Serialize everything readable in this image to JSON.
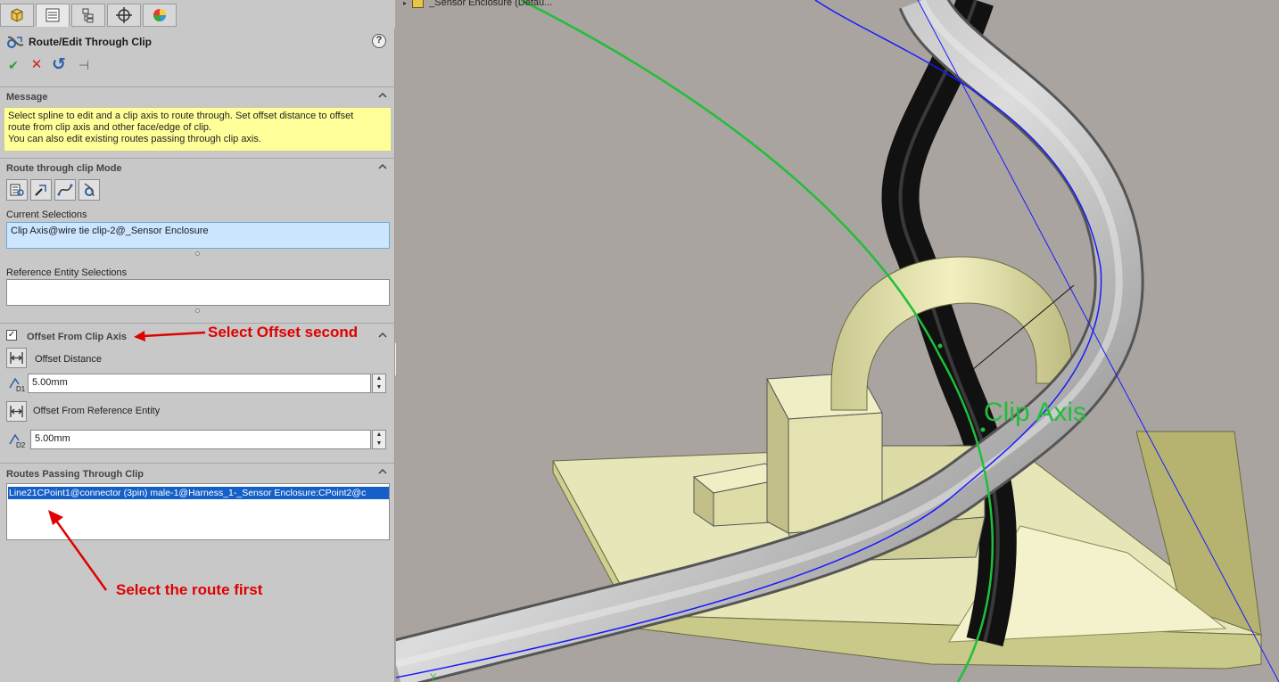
{
  "tabs": [
    {
      "name": "feature-manager",
      "icon": "feature-tree-icon"
    },
    {
      "name": "property-manager",
      "icon": "property-manager-icon"
    },
    {
      "name": "configuration-manager",
      "icon": "configuration-icon"
    },
    {
      "name": "dimxpert-manager",
      "icon": "crosshair-icon"
    },
    {
      "name": "display-manager",
      "icon": "appearance-icon"
    }
  ],
  "header": {
    "title": "Route/Edit Through Clip",
    "help": "?",
    "ok": "✔",
    "cancel": "✕",
    "undo": "↺",
    "pin": "⊣"
  },
  "message": {
    "title": "Message",
    "lines": [
      "Select spline to edit and a clip axis to route through. Set offset distance to offset",
      "route from clip axis and other face/edge of clip.",
      "You can also edit existing routes passing through clip axis."
    ]
  },
  "mode": {
    "title": "Route through clip Mode",
    "buttons": [
      "route-through-clip-icon",
      "select-spline-icon",
      "edit-spline-icon",
      "clip-axis-icon"
    ]
  },
  "current_selections": {
    "label": "Current Selections",
    "value": "Clip Axis@wire tie clip-2@_Sensor Enclosure"
  },
  "reference_entity": {
    "label": "Reference Entity Selections",
    "value": ""
  },
  "offset": {
    "checked": true,
    "title": "Offset From Clip Axis",
    "distance_label": "Offset Distance",
    "distance_value": "5.00mm",
    "distance_icon_text": "D1",
    "reference_label": "Offset From Reference Entity",
    "reference_value": "5.00mm",
    "reference_icon_text": "D2"
  },
  "routes": {
    "title": "Routes Passing Through Clip",
    "items": [
      "Line21CPoint1@connector (3pin) male-1@Harness_1-_Sensor Enclosure:CPoint2@c"
    ]
  },
  "annotations": {
    "offset_note": "Select Offset second",
    "route_note": "Select the route first",
    "color": "#e00000"
  },
  "viewport": {
    "tree_item": "_Sensor Enclosure  (Defau...",
    "clip_axis_label": "Clip Axis",
    "triad_label": "Y"
  },
  "colors": {
    "panel_bg": "#c8c8c8",
    "message_bg": "#ffff99",
    "selection_bg": "#cce6ff",
    "route_highlight": "#1560c8",
    "viewport_bg": "#a9a4a0",
    "green_spline": "#1fbf3a",
    "blue_axis": "#1a1aff"
  }
}
